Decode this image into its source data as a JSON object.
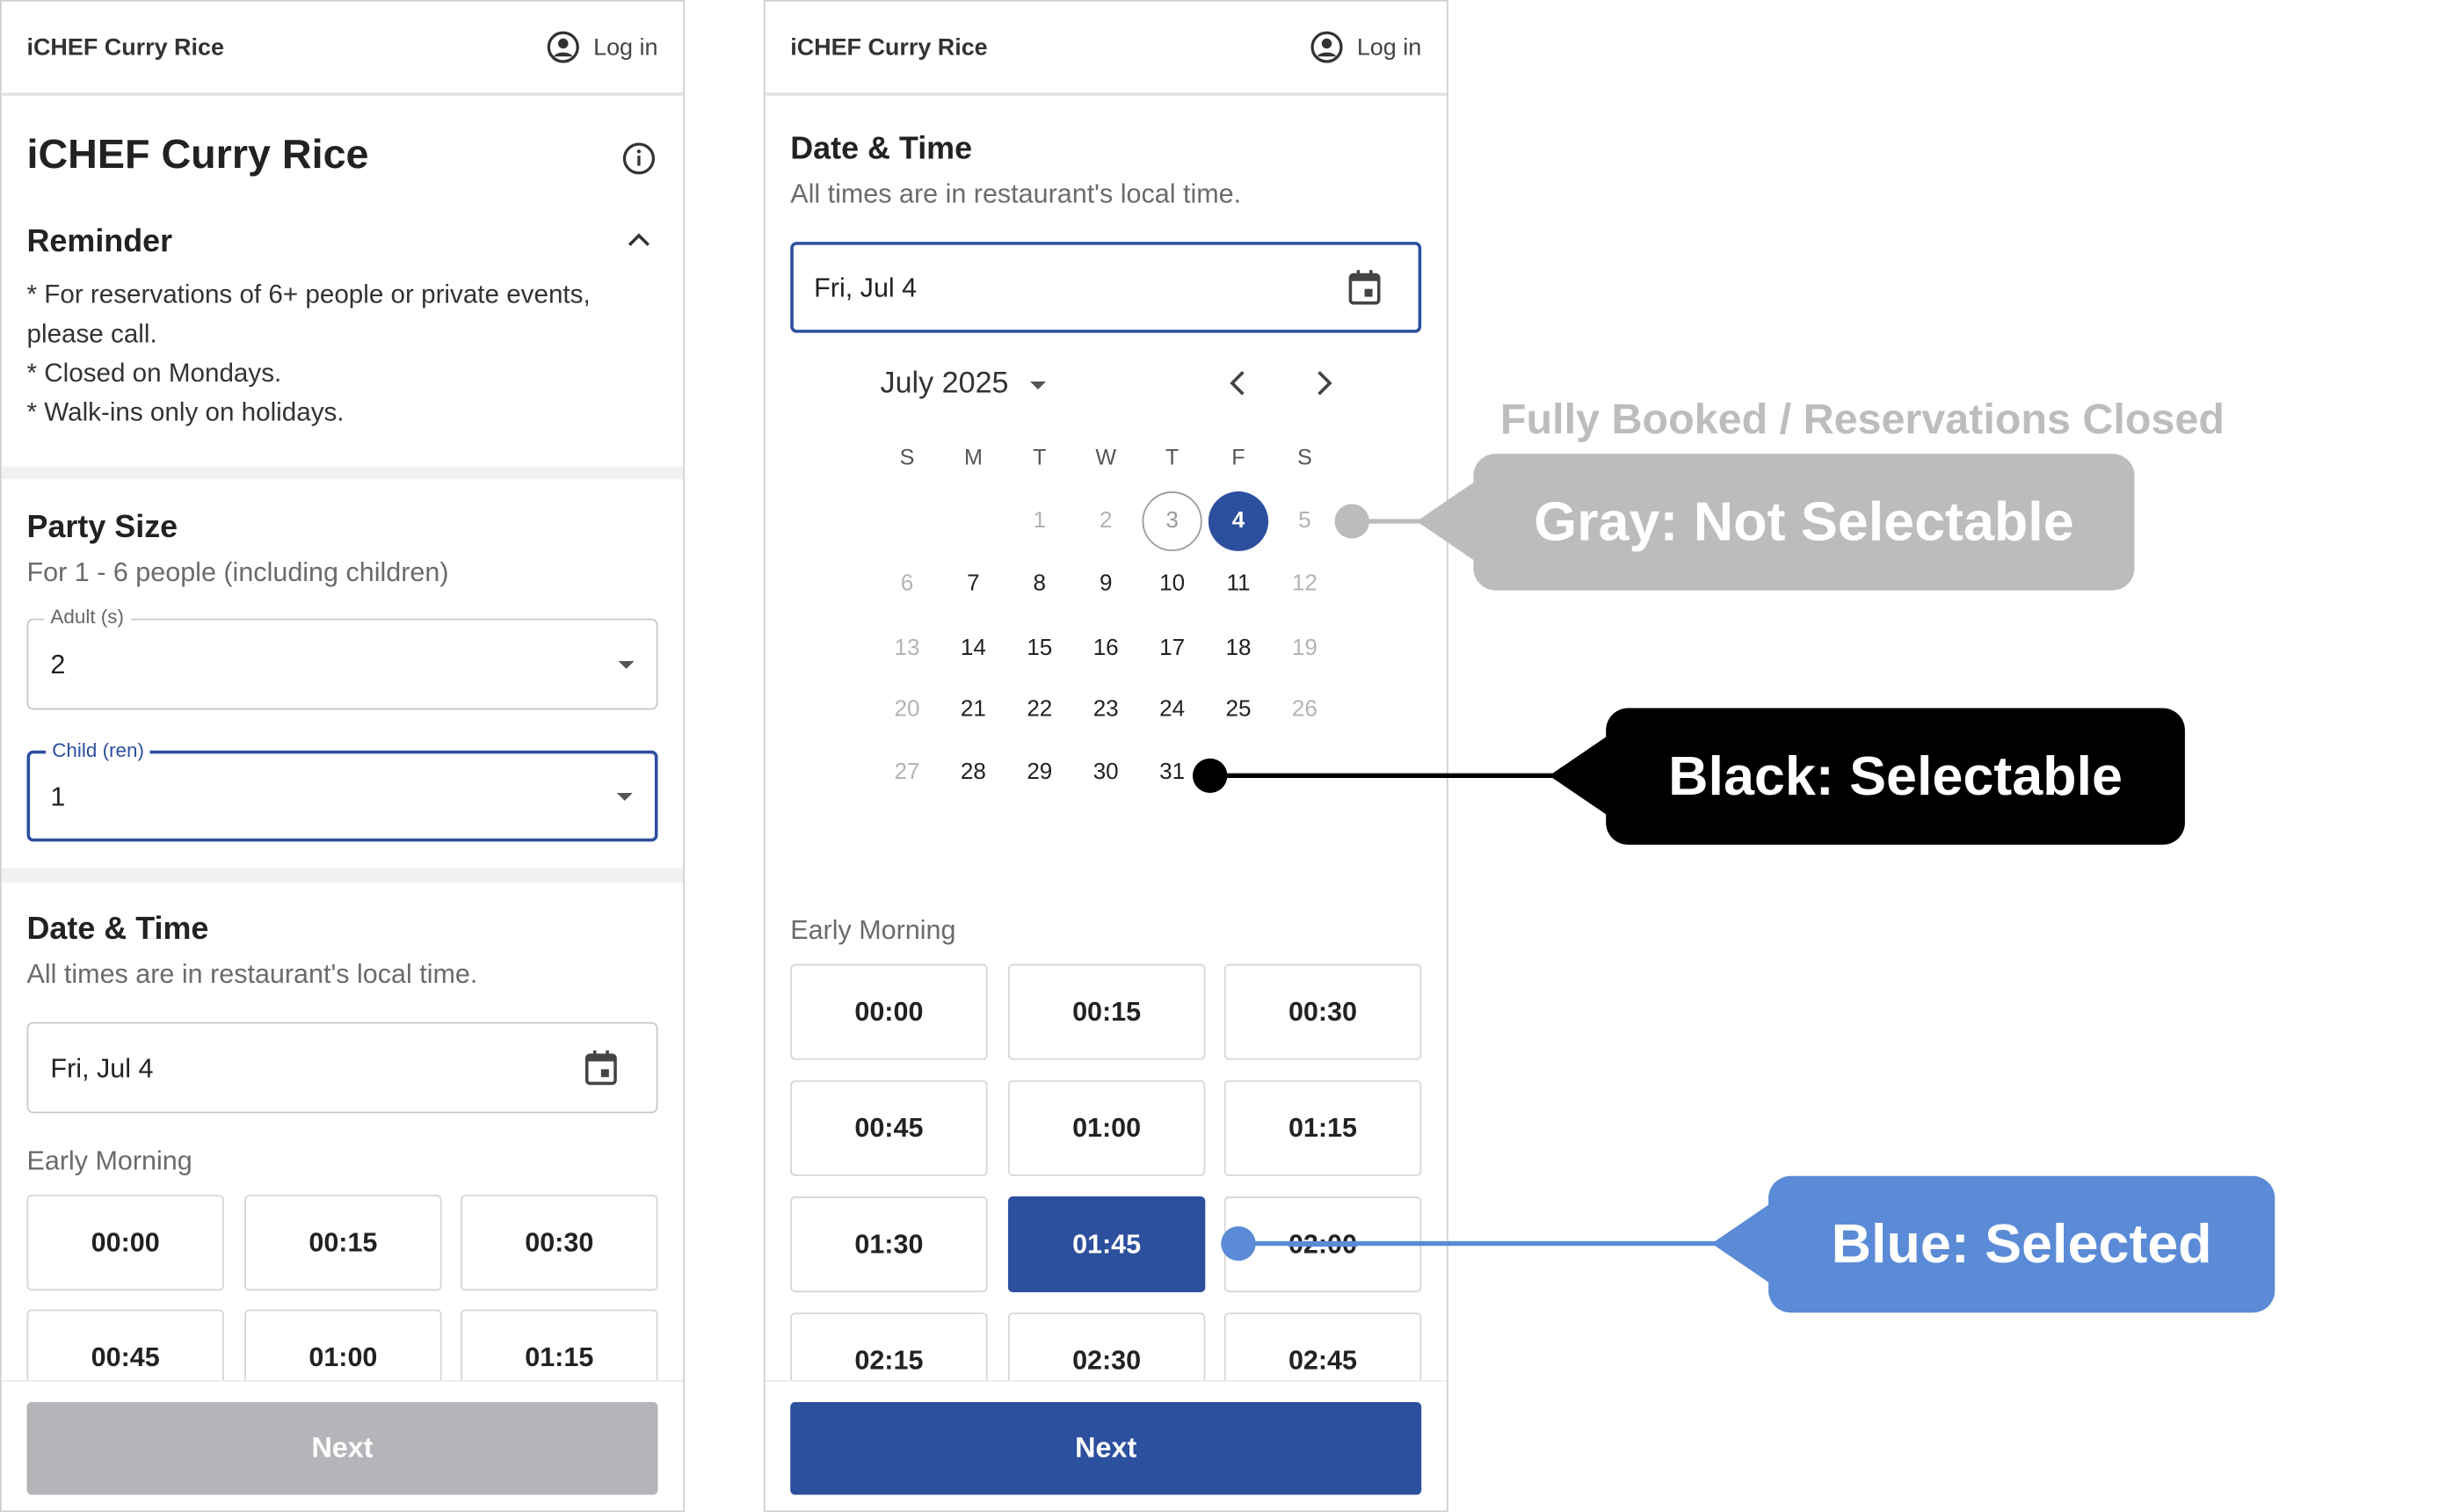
{
  "left_panel": {
    "brand": "iCHEF Curry Rice",
    "login_label": "Log in",
    "restaurant_name": "iCHEF Curry Rice",
    "reminder": {
      "title": "Reminder",
      "lines": [
        "* For reservations of 6+ people or private events, please call.",
        "* Closed on Mondays.",
        "* Walk-ins only on holidays."
      ]
    },
    "party_size": {
      "title": "Party Size",
      "subtitle": "For 1 - 6 people (including children)",
      "adult_label": "Adult (s)",
      "adult_value": "2",
      "child_label": "Child (ren)",
      "child_value": "1"
    },
    "date_time": {
      "title": "Date & Time",
      "subtitle": "All times are in restaurant's local time.",
      "date_value": "Fri, Jul 4",
      "section_label": "Early Morning",
      "slots": [
        "00:00",
        "00:15",
        "00:30",
        "00:45",
        "01:00",
        "01:15"
      ]
    },
    "next_label": "Next",
    "next_state": "disabled"
  },
  "right_panel": {
    "brand": "iCHEF Curry Rice",
    "login_label": "Log in",
    "date_time": {
      "title": "Date & Time",
      "subtitle": "All times are in restaurant's local time.",
      "date_value": "Fri, Jul 4"
    },
    "calendar": {
      "month_label": "July 2025",
      "weekday_headers": [
        "S",
        "M",
        "T",
        "W",
        "T",
        "F",
        "S"
      ],
      "selected_day": 4,
      "today_day": 3,
      "unavailable_days": [
        1,
        2,
        5,
        6,
        12,
        13,
        19,
        20,
        26,
        27
      ],
      "weeks": [
        [
          "",
          "",
          "1",
          "2",
          "3",
          "4",
          "5"
        ],
        [
          "6",
          "7",
          "8",
          "9",
          "10",
          "11",
          "12"
        ],
        [
          "13",
          "14",
          "15",
          "16",
          "17",
          "18",
          "19"
        ],
        [
          "20",
          "21",
          "22",
          "23",
          "24",
          "25",
          "26"
        ],
        [
          "27",
          "28",
          "29",
          "30",
          "31",
          "",
          ""
        ]
      ]
    },
    "section_label": "Early Morning",
    "slots": [
      "00:00",
      "00:15",
      "00:30",
      "00:45",
      "01:00",
      "01:15",
      "01:30",
      "01:45",
      "02:00",
      "02:15",
      "02:30",
      "02:45"
    ],
    "selected_slot": "01:45",
    "next_label": "Next",
    "next_state": "enabled"
  },
  "annotations": {
    "gray_title": "Fully Booked / Reservations Closed",
    "gray_label": "Gray: Not Selectable",
    "black_label": "Black: Selectable",
    "blue_label": "Blue: Selected",
    "colors": {
      "gray": "#bcbcbc",
      "black": "#000000",
      "blue": "#5b8bd6",
      "brand_blue": "#2c4f9e"
    }
  }
}
